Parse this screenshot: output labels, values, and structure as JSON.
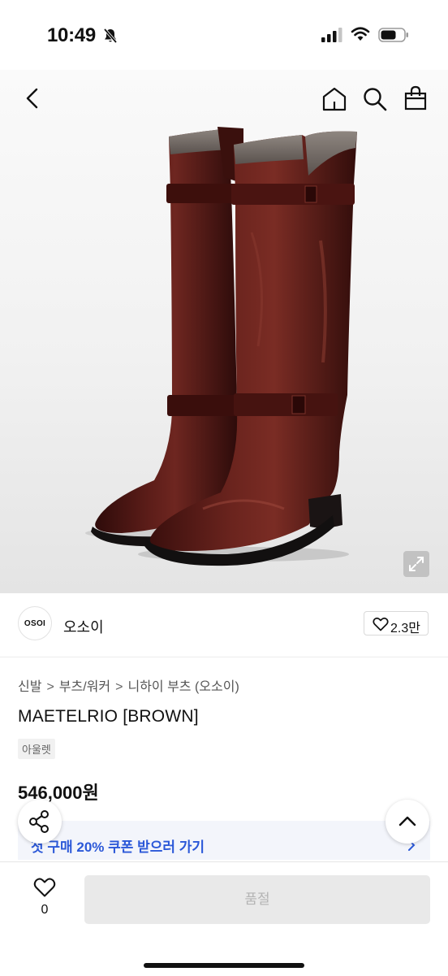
{
  "status_bar": {
    "time": "10:49"
  },
  "nav": {
    "back": "back-icon",
    "home": "home-icon",
    "search": "search-icon",
    "bag": "shopping-bag-icon"
  },
  "seller": {
    "logo_text": "OSOI",
    "name": "오소이",
    "likes": "2.3만"
  },
  "breadcrumb": {
    "items": [
      "신발",
      "부츠/워커",
      "니하이 부츠 (오소이)"
    ]
  },
  "product": {
    "name": "MAETELRIO [BROWN]",
    "tag": "아울렛",
    "price": "546,000원"
  },
  "coupon": {
    "text": "첫 구매 20% 쿠폰 받으러 가기"
  },
  "actions": {
    "wish_count": "0",
    "buy_label": "품절"
  },
  "colors": {
    "accent_blue": "#2b58d8",
    "boot_brown": "#4a1613"
  }
}
